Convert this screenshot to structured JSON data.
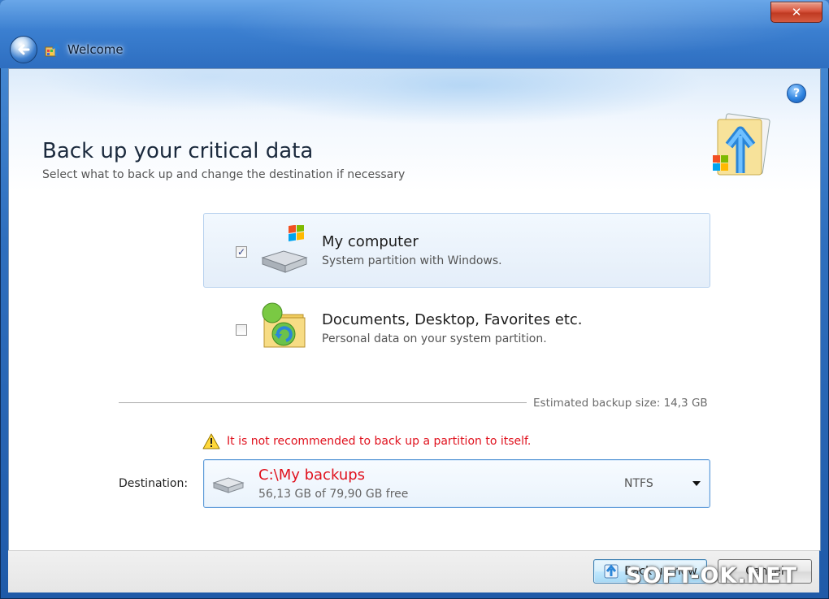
{
  "window": {
    "title": "Welcome",
    "close_label": "✕",
    "help_label": "?"
  },
  "page": {
    "heading": "Back up your critical data",
    "subheading": "Select what to back up and change the destination if necessary"
  },
  "options": [
    {
      "title": "My computer",
      "description": "System partition with Windows.",
      "checked": true,
      "check_mark": "✓",
      "icon": "computer-drive-windows-icon"
    },
    {
      "title": "Documents, Desktop, Favorites etc.",
      "description": "Personal data on your system partition.",
      "checked": false,
      "check_mark": "",
      "icon": "personal-folder-icon"
    }
  ],
  "estimate": {
    "text": "Estimated backup size:  14,3 GB"
  },
  "warning": {
    "text": "It is not recommended to back up a partition to itself.",
    "color": "#e0121e"
  },
  "destination": {
    "label": "Destination:",
    "path": "C:\\My backups",
    "free": "56,13 GB of 79,90 GB free",
    "filesystem": "NTFS"
  },
  "footer": {
    "backup_now": "Back up now",
    "cancel": "Cancel"
  },
  "watermark": {
    "text": "SOFT-OK.NET"
  },
  "colors": {
    "accent": "#3c7fb1",
    "warning": "#e0121e",
    "selection_border": "#b7d1ee"
  }
}
